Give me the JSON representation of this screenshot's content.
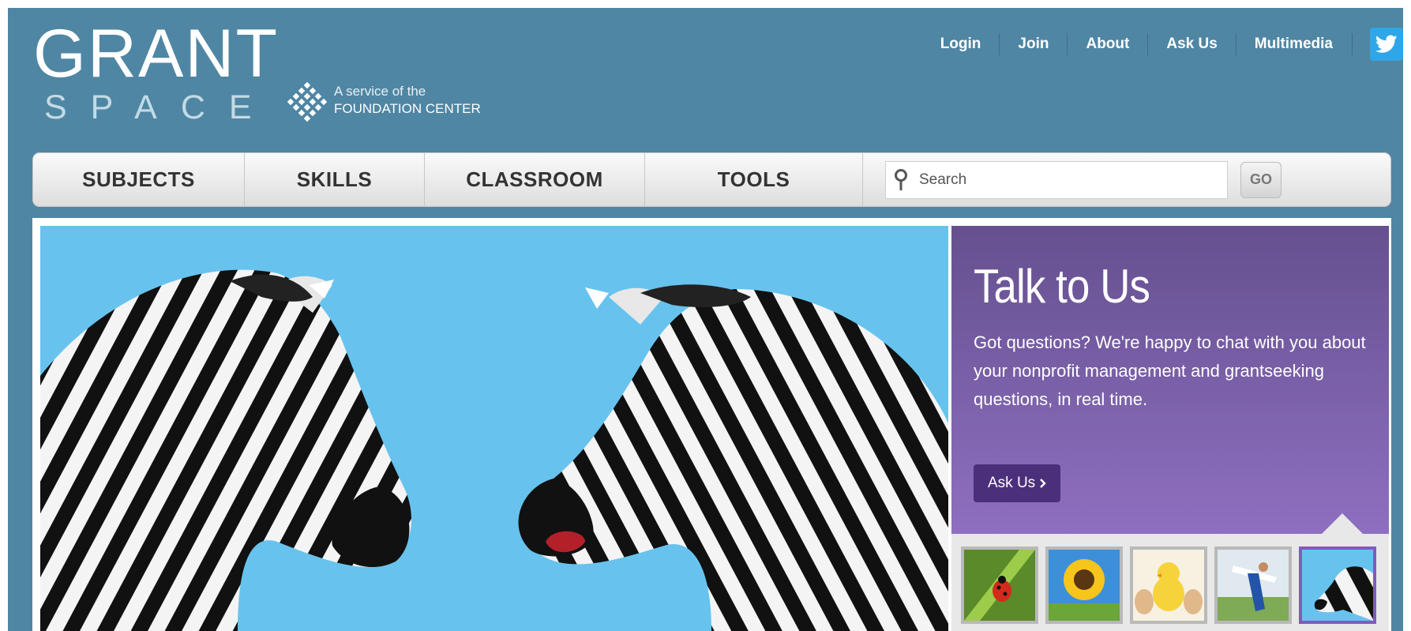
{
  "header": {
    "logo_line1": "GRANT",
    "logo_line2": "SPACE",
    "service_line1": "A service of the",
    "service_line2": "FOUNDATION CENTER",
    "top_links": [
      "Login",
      "Join",
      "About",
      "Ask Us",
      "Multimedia"
    ],
    "twitter_icon": "twitter-bird-icon"
  },
  "nav": {
    "items": [
      "SUBJECTS",
      "SKILLS",
      "CLASSROOM",
      "TOOLS"
    ],
    "search_placeholder": "Search",
    "go_label": "GO"
  },
  "talk": {
    "title": "Talk to Us",
    "body": "Got questions? We're happy to chat with you about your nonprofit management and grantseeking questions, in real time.",
    "button_label": "Ask Us",
    "button_icon": "chevron-right-icon"
  },
  "thumbnails": [
    {
      "subject": "ladybug",
      "active": false
    },
    {
      "subject": "sunflower",
      "active": false
    },
    {
      "subject": "chick",
      "active": false
    },
    {
      "subject": "runner",
      "active": false
    },
    {
      "subject": "zebra",
      "active": true
    }
  ],
  "colors": {
    "page_bg": "#4f86a3",
    "hero_bg": "#67c3ee",
    "talk_bg_top": "#65508f",
    "talk_bg_bottom": "#8e6fc0",
    "ask_button": "#4c2f7a",
    "twitter": "#2ea6e8"
  }
}
